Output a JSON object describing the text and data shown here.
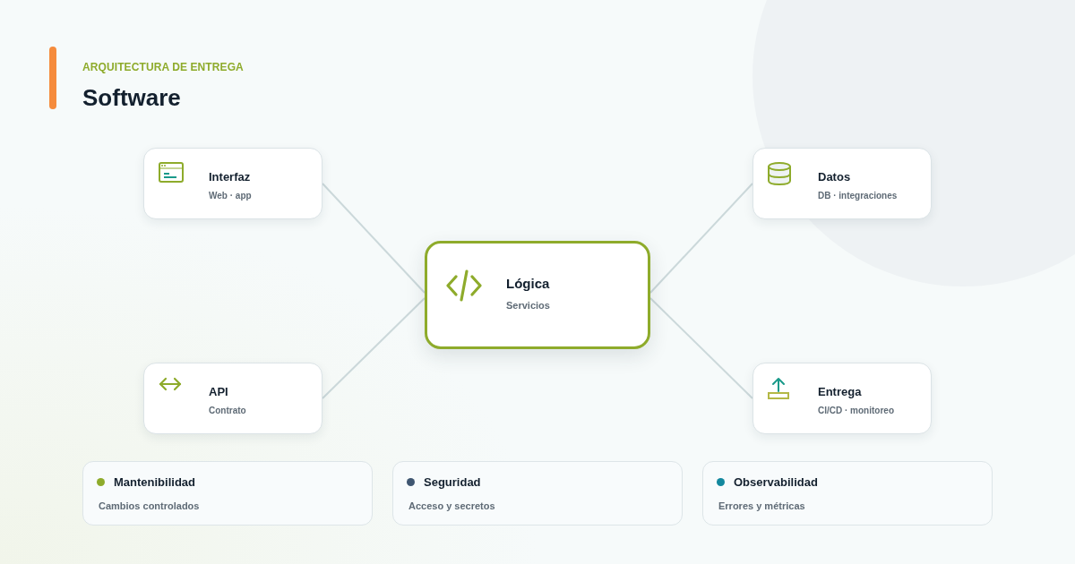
{
  "header": {
    "eyebrow": "ARQUITECTURA DE ENTREGA",
    "title": "Software"
  },
  "diagram": {
    "nodes": [
      {
        "kind": "satellite",
        "title": "Interfaz",
        "subtitle": "Web · app"
      },
      {
        "kind": "satellite",
        "title": "Datos",
        "subtitle": "DB · integraciones"
      },
      {
        "kind": "core",
        "title": "Lógica",
        "subtitle": "Servicios"
      },
      {
        "kind": "satellite",
        "title": "API",
        "subtitle": "Contrato"
      },
      {
        "kind": "satellite",
        "title": "Entrega",
        "subtitle": "CI/CD · monitoreo"
      }
    ]
  },
  "qualities": [
    {
      "title": "Mantenibilidad",
      "description": "Cambios controlados",
      "color": "#8eab2b"
    },
    {
      "title": "Seguridad",
      "description": "Acceso y secretos",
      "color": "#3f5671"
    },
    {
      "title": "Observabilidad",
      "description": "Errores y métricas",
      "color": "#13889e"
    }
  ]
}
